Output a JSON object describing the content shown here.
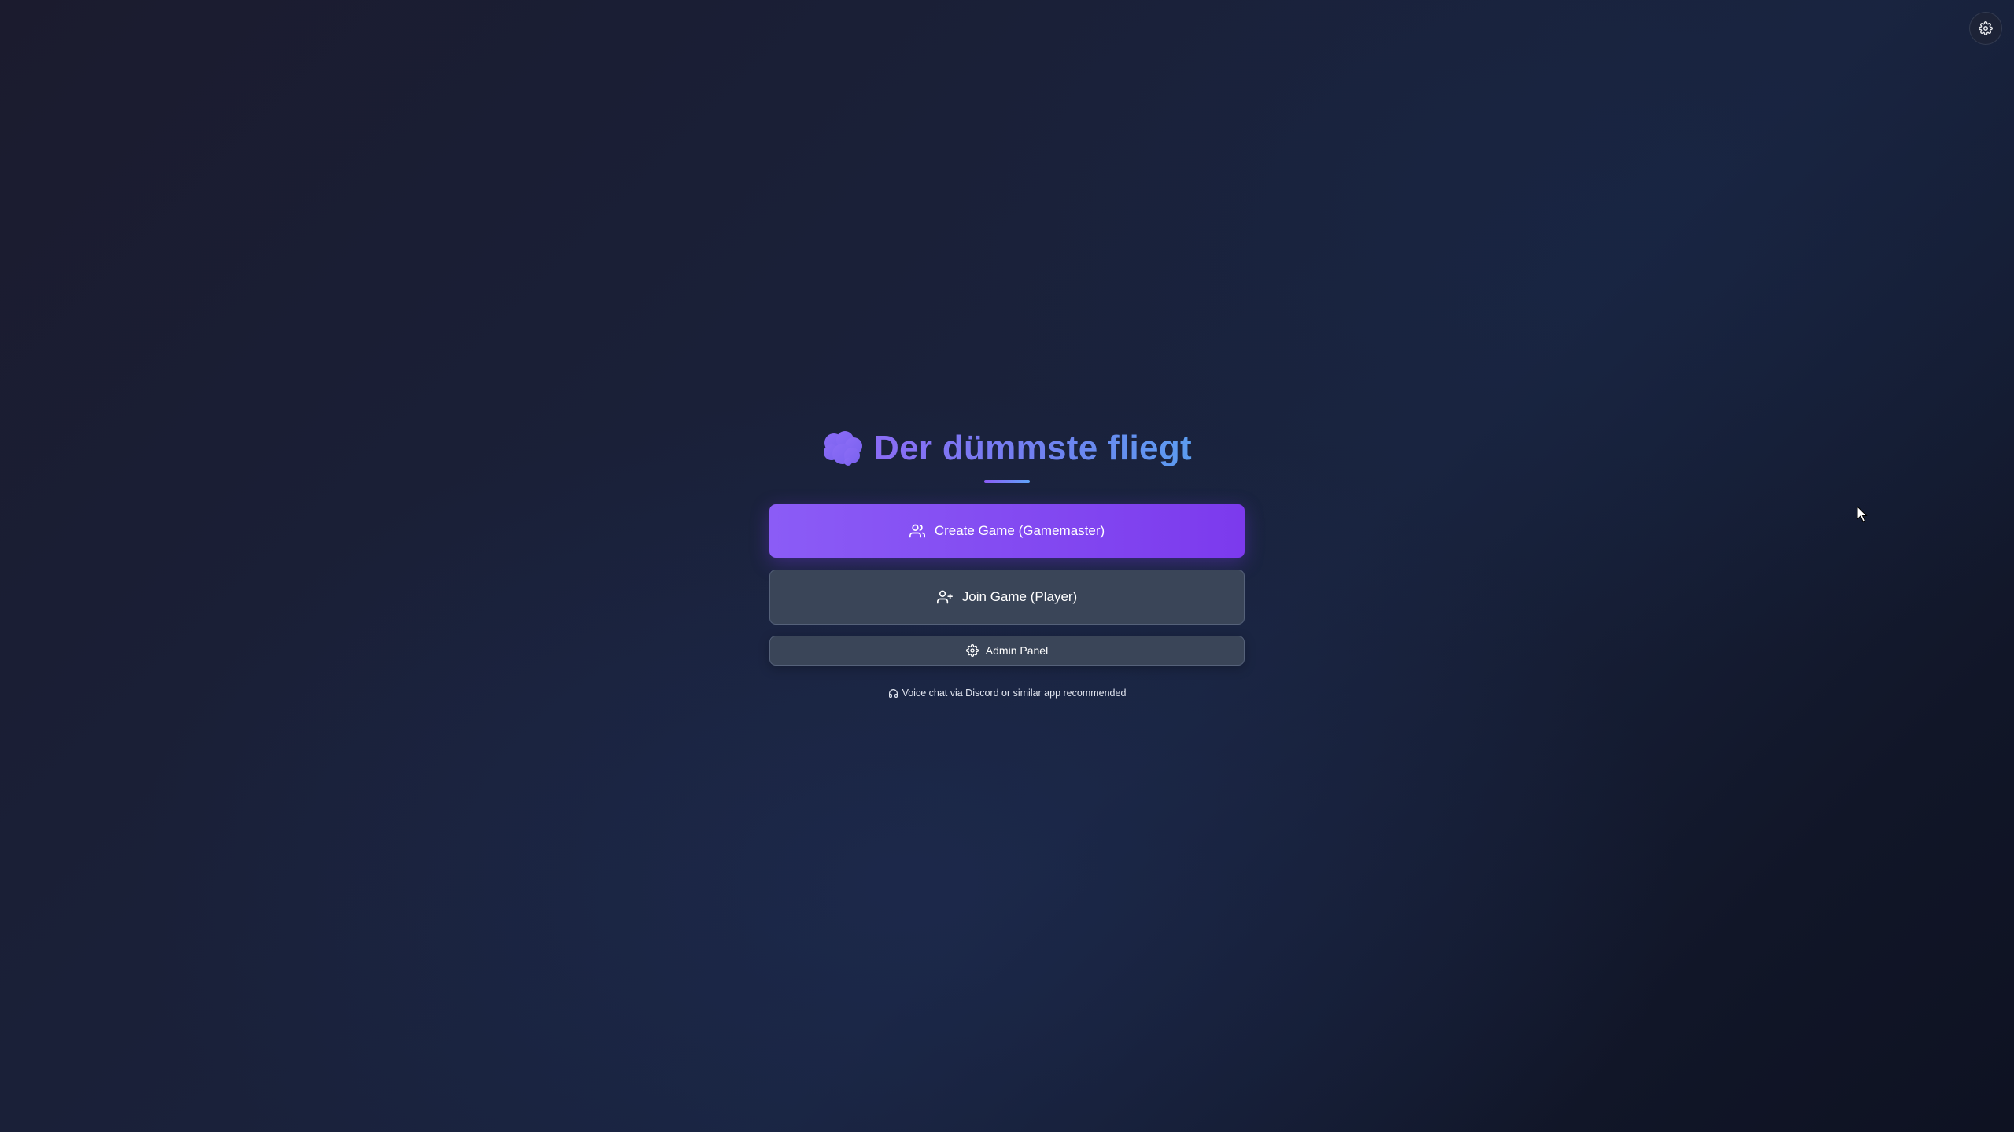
{
  "header": {
    "settings_icon": "gear-icon"
  },
  "hero": {
    "icon": "brain-icon",
    "title": "Der dümmste fliegt",
    "title_gradient": [
      "#8a6cf5",
      "#5b9cf0"
    ]
  },
  "actions": {
    "create_label": "Create Game (Gamemaster)",
    "create_icon": "users-icon",
    "join_label": "Join Game (Player)",
    "join_icon": "user-plus-icon",
    "admin_label": "Admin Panel",
    "admin_icon": "gear-icon"
  },
  "footer": {
    "voice_note": "Voice chat via Discord or similar app recommended",
    "voice_icon": "headphones-icon"
  },
  "colors": {
    "primary": "#7c3aed",
    "secondary_button": "#3a4558",
    "accent_blue": "#60a5fa"
  }
}
